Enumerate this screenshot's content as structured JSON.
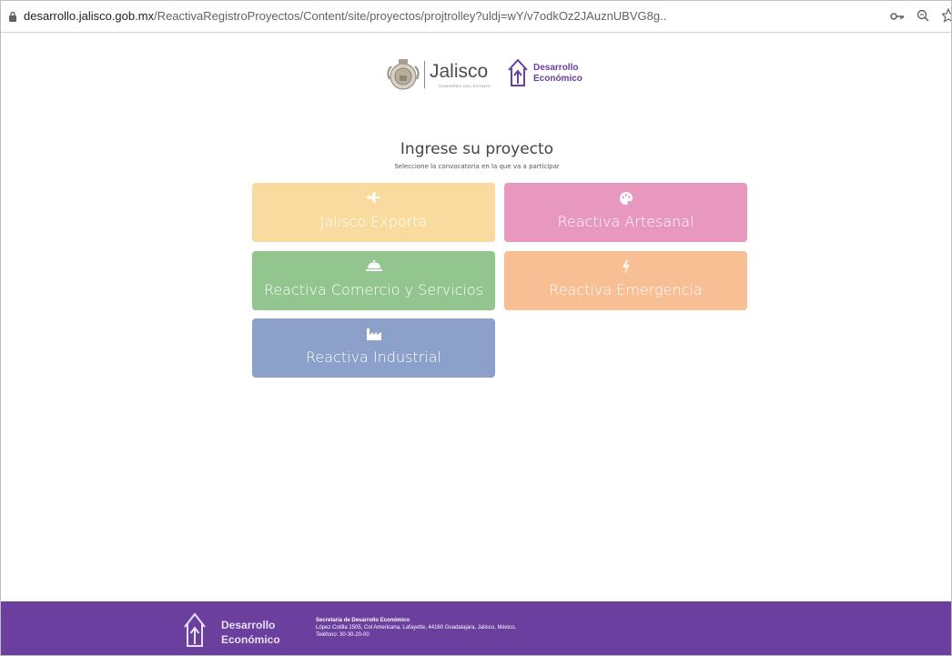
{
  "browser": {
    "url_host": "desarrollo.jalisco.gob.mx",
    "url_path": "/ReactivaRegistroProyectos/Content/site/proyectos/projtrolley?uldj=wY/v7odkOz2JAuznUBVG8g.."
  },
  "header": {
    "jalisco_word": "Jalisco",
    "jalisco_sub": "GOBIERNO DEL ESTADO",
    "de_line1": "Desarrollo",
    "de_line2": "Económico"
  },
  "main": {
    "title": "Ingrese su proyecto",
    "subtitle": "Seleccione la convocatoria en la que va a participar",
    "cards": [
      {
        "label": "Jalisco Exporta",
        "icon": "airplane-icon",
        "color": "#f9dba0"
      },
      {
        "label": "Reactiva Artesanal",
        "icon": "palette-icon",
        "color": "#e898bf"
      },
      {
        "label": "Reactiva Comercio y Servicios",
        "icon": "service-bell-icon",
        "color": "#92c68e"
      },
      {
        "label": "Reactiva Emergencia",
        "icon": "lightning-icon",
        "color": "#f8bf95"
      },
      {
        "label": "Reactiva Industrial",
        "icon": "factory-icon",
        "color": "#8ca1c9"
      }
    ]
  },
  "footer": {
    "brand_line1": "Desarrollo",
    "brand_line2": "Económico",
    "info_title": "Secretaría de Desarrollo Económico",
    "info_address": "López Cotilla 1505, Col Americana, Lafayette, 44160 Guadalajara, Jalisco, México.",
    "info_phone": "Teléfono: 30-30-20-00",
    "background": "#6a3f9e"
  }
}
